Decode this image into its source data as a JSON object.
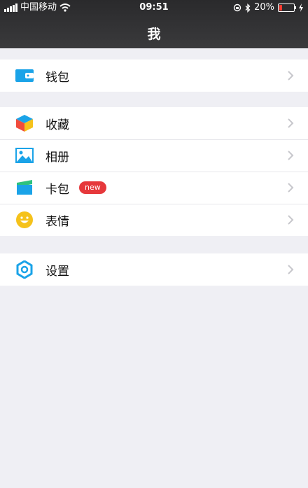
{
  "status_bar": {
    "carrier": "中国移动",
    "time": "09:51",
    "battery": "20%",
    "battery_level": 0.2
  },
  "nav": {
    "title": "我"
  },
  "groups": [
    {
      "items": [
        {
          "label": "钱包",
          "icon": "wallet-icon"
        }
      ]
    },
    {
      "items": [
        {
          "label": "收藏",
          "icon": "favorites-cube-icon"
        },
        {
          "label": "相册",
          "icon": "album-photo-icon"
        },
        {
          "label": "卡包",
          "icon": "card-pack-icon",
          "badge": "new"
        },
        {
          "label": "表情",
          "icon": "smiley-icon"
        }
      ]
    },
    {
      "items": [
        {
          "label": "设置",
          "icon": "settings-gear-icon"
        }
      ]
    }
  ],
  "colors": {
    "accent_blue": "#1aa3e8",
    "badge_red": "#e6383b",
    "smiley_yellow": "#f5c21b"
  }
}
